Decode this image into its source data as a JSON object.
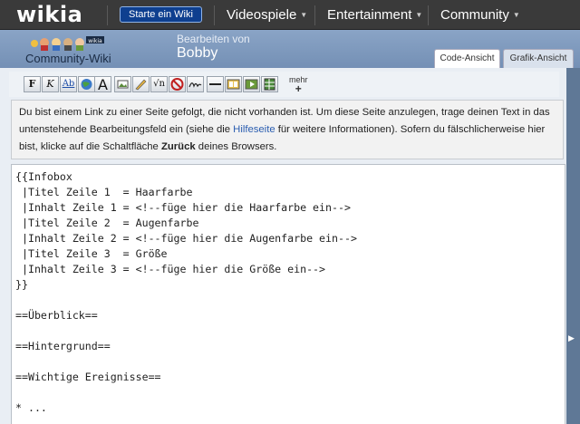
{
  "topnav": {
    "logo": "wikia",
    "start_button": "Starte ein Wiki",
    "items": [
      {
        "label": "Videospiele"
      },
      {
        "label": "Entertainment"
      },
      {
        "label": "Community"
      }
    ]
  },
  "wiki": {
    "wordmark": "Community-Wiki",
    "edit_label": "Bearbeiten von",
    "page_name": "Bobby"
  },
  "tabs": {
    "code_view": "Code-Ansicht",
    "visual_view": "Grafik-Ansicht"
  },
  "toolbar": {
    "bold": "F",
    "italic": "K",
    "link": "Ab",
    "heading": "A",
    "more_label": "mehr",
    "more_plus": "+"
  },
  "notice": {
    "part1": "Du bist einem Link zu einer Seite gefolgt, die nicht vorhanden ist. Um diese Seite anzulegen, trage deinen Text in das untenstehende Bearbeitungsfeld ein (siehe die ",
    "link": "Hilfeseite",
    "part2": " für weitere Informationen). Sofern du fälschlicherweise hier bist, klicke auf die Schaltfläche ",
    "bold": "Zurück",
    "part3": " deines Browsers."
  },
  "editor": {
    "lines": [
      "{{Infobox",
      " |Titel Zeile 1  = Haarfarbe",
      " |Inhalt Zeile 1 = <!--füge hier die Haarfarbe ein-->",
      " |Titel Zeile 2  = Augenfarbe",
      " |Inhalt Zeile 2 = <!--füge hier die Augenfarbe ein-->",
      " |Titel Zeile 3  = Größe",
      " |Inhalt Zeile 3 = <!--füge hier die Größe ein-->",
      "}}",
      "",
      "==Überblick==",
      "",
      "==Hintergrund==",
      "",
      "==Wichtige Ereignisse==",
      "",
      "* ..."
    ]
  }
}
